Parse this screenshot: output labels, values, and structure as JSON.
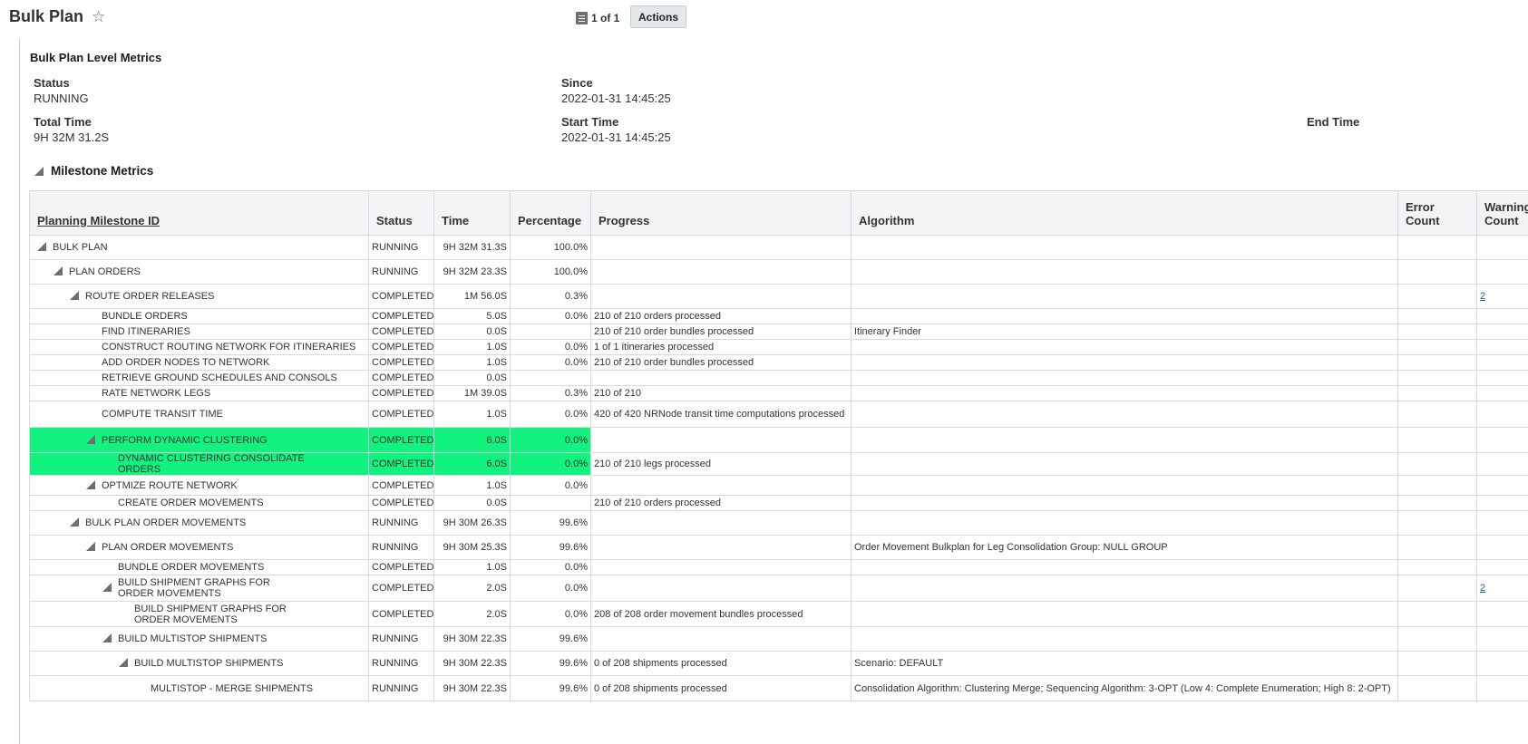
{
  "header": {
    "title": "Bulk Plan",
    "pager_text": "1 of 1",
    "actions_label": "Actions"
  },
  "bulk_plan_metrics": {
    "section_title": "Bulk Plan Level Metrics",
    "status_label": "Status",
    "status_value": "RUNNING",
    "since_label": "Since",
    "since_value": "2022-01-31 14:45:25",
    "total_time_label": "Total Time",
    "total_time_value": "9H 32M 31.2S",
    "start_time_label": "Start Time",
    "start_time_value": "2022-01-31 14:45:25",
    "end_time_label": "End Time",
    "end_time_value": ""
  },
  "milestone_metrics": {
    "section_title": "Milestone Metrics",
    "columns": {
      "id": "Planning Milestone ID",
      "status": "Status",
      "time": "Time",
      "percentage": "Percentage",
      "progress": "Progress",
      "algorithm": "Algorithm",
      "error_count": "Error Count",
      "warning_count": "Warning Count"
    },
    "rows": [
      {
        "name": "BULK PLAN",
        "level": 0,
        "expanded": true,
        "status": "RUNNING",
        "time": "9H 32M 31.3S",
        "percentage": "100.0%",
        "progress": "",
        "algorithm": "",
        "error_count": "",
        "warning_count": "",
        "highlight": false
      },
      {
        "name": "PLAN ORDERS",
        "level": 1,
        "expanded": true,
        "status": "RUNNING",
        "time": "9H 32M 23.3S",
        "percentage": "100.0%",
        "progress": "",
        "algorithm": "",
        "error_count": "",
        "warning_count": "",
        "highlight": false
      },
      {
        "name": "ROUTE ORDER RELEASES",
        "level": 2,
        "expanded": true,
        "status": "COMPLETED",
        "time": "1M 56.0S",
        "percentage": "0.3%",
        "progress": "",
        "algorithm": "",
        "error_count": "",
        "warning_count": "2",
        "highlight": false
      },
      {
        "name": "BUNDLE ORDERS",
        "level": 3,
        "expanded": false,
        "status": "COMPLETED",
        "time": "5.0S",
        "percentage": "0.0%",
        "progress": "210 of 210 orders processed",
        "algorithm": "",
        "error_count": "",
        "warning_count": "",
        "highlight": false
      },
      {
        "name": "FIND ITINERARIES",
        "level": 3,
        "expanded": false,
        "status": "COMPLETED",
        "time": "0.0S",
        "percentage": "",
        "progress": "210 of 210 order bundles processed",
        "algorithm": "Itinerary Finder",
        "error_count": "",
        "warning_count": "",
        "highlight": false
      },
      {
        "name": "CONSTRUCT ROUTING NETWORK FOR ITINERARIES",
        "level": 3,
        "expanded": false,
        "status": "COMPLETED",
        "time": "1.0S",
        "percentage": "0.0%",
        "progress": "1 of 1 itineraries processed",
        "algorithm": "",
        "error_count": "",
        "warning_count": "",
        "highlight": false
      },
      {
        "name": "ADD ORDER NODES TO NETWORK",
        "level": 3,
        "expanded": false,
        "status": "COMPLETED",
        "time": "1.0S",
        "percentage": "0.0%",
        "progress": "210 of 210 order bundles processed",
        "algorithm": "",
        "error_count": "",
        "warning_count": "",
        "highlight": false
      },
      {
        "name": "RETRIEVE GROUND SCHEDULES AND CONSOLS",
        "level": 3,
        "expanded": false,
        "status": "COMPLETED",
        "time": "0.0S",
        "percentage": "",
        "progress": "",
        "algorithm": "",
        "error_count": "",
        "warning_count": "",
        "highlight": false
      },
      {
        "name": "RATE NETWORK LEGS",
        "level": 3,
        "expanded": false,
        "status": "COMPLETED",
        "time": "1M 39.0S",
        "percentage": "0.3%",
        "progress": "210 of 210",
        "algorithm": "",
        "error_count": "",
        "warning_count": "",
        "highlight": false
      },
      {
        "name": "COMPUTE TRANSIT TIME",
        "level": 3,
        "expanded": false,
        "status": "COMPLETED",
        "time": "1.0S",
        "percentage": "0.0%",
        "progress": "420 of 420 NRNode transit time computations processed",
        "algorithm": "",
        "error_count": "",
        "warning_count": "",
        "highlight": false
      },
      {
        "name": "PERFORM DYNAMIC CLUSTERING",
        "level": 3,
        "expanded": true,
        "status": "COMPLETED",
        "time": "6.0S",
        "percentage": "0.0%",
        "progress": "",
        "algorithm": "",
        "error_count": "",
        "warning_count": "",
        "highlight": true
      },
      {
        "name": "DYNAMIC CLUSTERING CONSOLIDATE ORDERS",
        "level": 4,
        "expanded": false,
        "status": "COMPLETED",
        "time": "6.0S",
        "percentage": "0.0%",
        "progress": "210 of 210 legs processed",
        "algorithm": "",
        "error_count": "",
        "warning_count": "",
        "highlight": true
      },
      {
        "name": "OPTMIZE ROUTE NETWORK",
        "level": 3,
        "expanded": true,
        "status": "COMPLETED",
        "time": "1.0S",
        "percentage": "0.0%",
        "progress": "",
        "algorithm": "",
        "error_count": "",
        "warning_count": "",
        "highlight": false
      },
      {
        "name": "CREATE ORDER MOVEMENTS",
        "level": 4,
        "expanded": false,
        "status": "COMPLETED",
        "time": "0.0S",
        "percentage": "",
        "progress": "210 of 210 orders processed",
        "algorithm": "",
        "error_count": "",
        "warning_count": "",
        "highlight": false
      },
      {
        "name": "BULK PLAN ORDER MOVEMENTS",
        "level": 2,
        "expanded": true,
        "status": "RUNNING",
        "time": "9H 30M 26.3S",
        "percentage": "99.6%",
        "progress": "",
        "algorithm": "",
        "error_count": "",
        "warning_count": "",
        "highlight": false
      },
      {
        "name": "PLAN ORDER MOVEMENTS",
        "level": 3,
        "expanded": true,
        "status": "RUNNING",
        "time": "9H 30M 25.3S",
        "percentage": "99.6%",
        "progress": "",
        "algorithm": "Order Movement Bulkplan for Leg Consolidation Group: NULL GROUP",
        "error_count": "",
        "warning_count": "",
        "highlight": false
      },
      {
        "name": "BUNDLE ORDER MOVEMENTS",
        "level": 4,
        "expanded": false,
        "status": "COMPLETED",
        "time": "1.0S",
        "percentage": "0.0%",
        "progress": "",
        "algorithm": "",
        "error_count": "",
        "warning_count": "",
        "highlight": false
      },
      {
        "name": "BUILD SHIPMENT GRAPHS FOR ORDER MOVEMENTS",
        "level": 4,
        "expanded": true,
        "status": "COMPLETED",
        "time": "2.0S",
        "percentage": "0.0%",
        "progress": "",
        "algorithm": "",
        "error_count": "",
        "warning_count": "2",
        "highlight": false
      },
      {
        "name": "BUILD SHIPMENT GRAPHS FOR ORDER MOVEMENTS",
        "level": 5,
        "expanded": false,
        "status": "COMPLETED",
        "time": "2.0S",
        "percentage": "0.0%",
        "progress": "208 of 208 order movement bundles processed",
        "algorithm": "",
        "error_count": "",
        "warning_count": "",
        "highlight": false
      },
      {
        "name": "BUILD MULTISTOP SHIPMENTS",
        "level": 4,
        "expanded": true,
        "status": "RUNNING",
        "time": "9H 30M 22.3S",
        "percentage": "99.6%",
        "progress": "",
        "algorithm": "",
        "error_count": "",
        "warning_count": "",
        "highlight": false
      },
      {
        "name": "BUILD MULTISTOP SHIPMENTS",
        "level": 5,
        "expanded": true,
        "status": "RUNNING",
        "time": "9H 30M 22.3S",
        "percentage": "99.6%",
        "progress": "0 of 208 shipments processed",
        "algorithm": "Scenario: DEFAULT",
        "error_count": "",
        "warning_count": "",
        "highlight": false
      },
      {
        "name": "MULTISTOP - MERGE SHIPMENTS",
        "level": 6,
        "expanded": false,
        "status": "RUNNING",
        "time": "9H 30M 22.3S",
        "percentage": "99.6%",
        "progress": "0 of 208 shipments processed",
        "algorithm": "Consolidation Algorithm: Clustering Merge; Sequencing Algorithm: 3-OPT (Low 4: Complete Enumeration; High 8: 2-OPT)",
        "error_count": "",
        "warning_count": "",
        "highlight": false
      }
    ]
  }
}
